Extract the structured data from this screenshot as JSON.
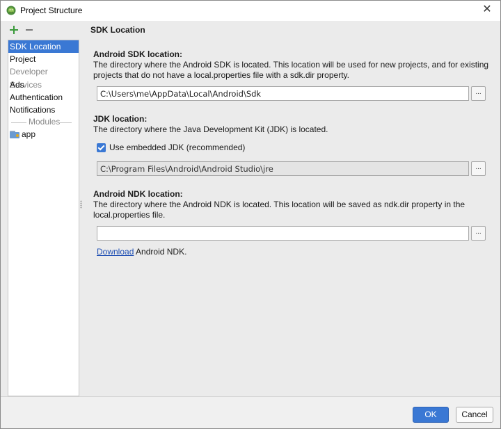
{
  "window": {
    "title": "Project Structure",
    "close_glyph": "✕"
  },
  "sidebar": {
    "add_icon": "plus-icon",
    "remove_icon": "minus-icon",
    "items": [
      {
        "label": "SDK Location",
        "selected": true
      },
      {
        "label": "Project",
        "selected": false
      }
    ],
    "developer_services": {
      "heading": "Developer Services",
      "items": [
        "Ads",
        "Authentication",
        "Notifications"
      ]
    },
    "modules": {
      "heading": "Modules",
      "items": [
        {
          "label": "app",
          "icon": "module-folder-icon"
        }
      ]
    }
  },
  "main": {
    "panel_title": "SDK Location",
    "android_sdk": {
      "heading": "Android SDK location:",
      "description": "The directory where the Android SDK is located. This location will be used for new projects, and for existing projects that do not have a local.properties file with a sdk.dir property.",
      "path": "C:\\Users\\me\\AppData\\Local\\Android\\Sdk",
      "browse_label": "..."
    },
    "jdk": {
      "heading": "JDK location:",
      "description": "The directory where the Java Development Kit (JDK) is located.",
      "use_embedded_label": "Use embedded JDK (recommended)",
      "use_embedded_checked": true,
      "path": "C:\\Program Files\\Android\\Android Studio\\jre",
      "browse_label": "..."
    },
    "ndk": {
      "heading": "Android NDK location:",
      "description": "The directory where the Android NDK is located. This location will be saved as ndk.dir property in the local.properties file.",
      "path": "",
      "browse_label": "...",
      "download_link": "Download",
      "download_suffix": " Android NDK."
    }
  },
  "footer": {
    "ok_label": "OK",
    "cancel_label": "Cancel"
  },
  "colors": {
    "accent": "#3a78d4",
    "link": "#1f4fb3",
    "add_green": "#3a9a3a"
  }
}
